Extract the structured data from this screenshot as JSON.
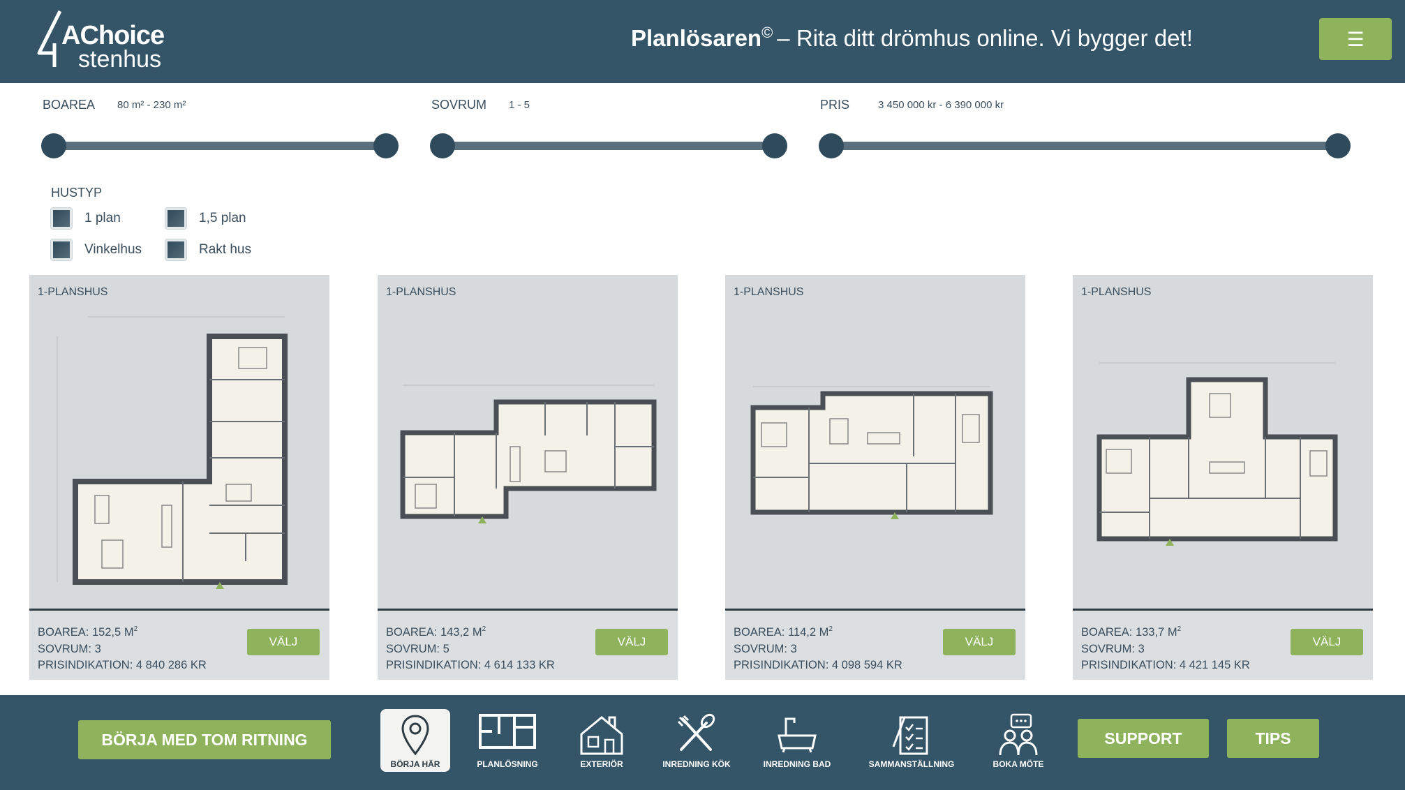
{
  "header": {
    "logo_line1": "AChoice",
    "logo_line2": "stenhus",
    "tagline_brand": "Planlösaren",
    "tagline_mark": "©",
    "tagline_text": "– Rita ditt drömhus online. Vi bygger det!",
    "menu_icon": "☰"
  },
  "filters": {
    "boarea": {
      "label": "BOAREA",
      "range": "80 m² - 230 m²",
      "min": 80,
      "max": 230,
      "value_low": 80,
      "value_high": 230
    },
    "sovrum": {
      "label": "SOVRUM",
      "range": "1 - 5",
      "min": 1,
      "max": 5,
      "value_low": 1,
      "value_high": 5
    },
    "pris": {
      "label": "PRIS",
      "range": "3 450 000 kr - 6 390 000 kr",
      "min": 3450000,
      "max": 6390000,
      "value_low": 3450000,
      "value_high": 6390000
    },
    "hustyp": {
      "title": "HUSTYP",
      "options": [
        "1 plan",
        "1,5 plan",
        "Vinkelhus",
        "Rakt hus"
      ]
    }
  },
  "cards": [
    {
      "type": "1-PLANSHUS",
      "boarea": "BOAREA: 152,5 M",
      "sovrum": "SOVRUM: 3",
      "pris": "PRISINDIKATION: 4 840 286 KR",
      "button": "VÄLJ"
    },
    {
      "type": "1-PLANSHUS",
      "boarea": "BOAREA: 143,2 M",
      "sovrum": "SOVRUM: 5",
      "pris": "PRISINDIKATION: 4 614 133 KR",
      "button": "VÄLJ"
    },
    {
      "type": "1-PLANSHUS",
      "boarea": "BOAREA: 114,2 M",
      "sovrum": "SOVRUM: 3",
      "pris": "PRISINDIKATION: 4 098 594 KR",
      "button": "VÄLJ"
    },
    {
      "type": "1-PLANSHUS",
      "boarea": "BOAREA: 133,7 M",
      "sovrum": "SOVRUM: 3",
      "pris": "PRISINDIKATION: 4 421 145 KR",
      "button": "VÄLJ"
    }
  ],
  "area_unit_sup": "2",
  "bottom": {
    "start_blank": "BÖRJA MED TOM RITNING",
    "nav": [
      {
        "label": "BÖRJA HÄR",
        "icon": "map-pin-icon"
      },
      {
        "label": "PLANLÖSNING",
        "icon": "floor-plan-icon"
      },
      {
        "label": "EXTERIÖR",
        "icon": "house-icon"
      },
      {
        "label": "INREDNING KÖK",
        "icon": "utensils-icon"
      },
      {
        "label": "INREDNING BAD",
        "icon": "bathtub-icon"
      },
      {
        "label": "SAMMANSTÄLLNING",
        "icon": "checklist-icon"
      },
      {
        "label": "BOKA MÖTE",
        "icon": "meeting-icon"
      }
    ],
    "support": "SUPPORT",
    "tips": "TIPS"
  },
  "colors": {
    "header_bg": "#345467",
    "accent_green": "#8fb35c",
    "card_bg": "#dcdfe2",
    "plan_fill": "#f3f1e8",
    "plan_wall": "#4a4f55"
  }
}
